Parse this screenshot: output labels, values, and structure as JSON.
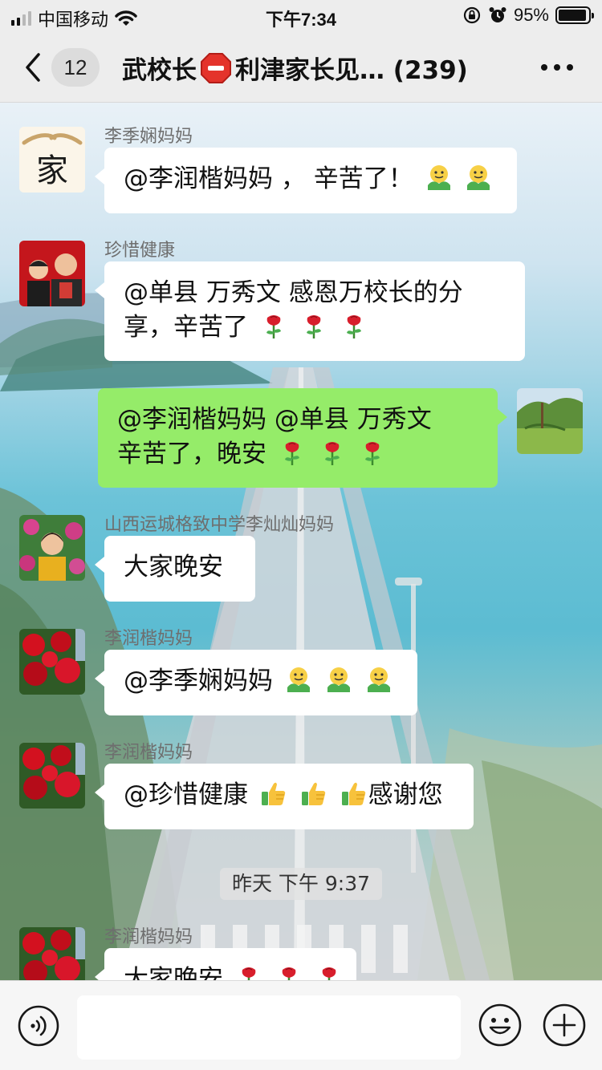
{
  "status_bar": {
    "carrier": "中国移动",
    "time": "下午7:34",
    "battery": "95%",
    "battery_level": 0.95,
    "signal_bars": 2
  },
  "header": {
    "unread_count": "12",
    "title_part1": "武校长",
    "title_icon": "stop-sign-emoji",
    "title_part2": "利津家长见… (239)"
  },
  "messages": [
    {
      "sender": "李季娴妈妈",
      "text": "@李润楷妈妈 ， 辛苦了！",
      "emojis": [
        "hugging-face",
        "hugging-face"
      ]
    },
    {
      "sender": "珍惜健康",
      "text_line1": "@单县  万秀文 感恩万校长的分",
      "text_line2": "享，辛苦了",
      "emojis": [
        "rose",
        "rose",
        "rose"
      ]
    },
    {
      "sender": "",
      "mine": true,
      "text_line1": "@李润楷妈妈 @单县  万秀文",
      "text_line2": "辛苦了，晚安",
      "emojis": [
        "rose",
        "rose",
        "rose"
      ]
    },
    {
      "sender": "山西运城格致中学李灿灿妈妈",
      "text": "大家晚安"
    },
    {
      "sender": "李润楷妈妈",
      "text": "@李季娴妈妈",
      "emojis": [
        "hugging-face",
        "hugging-face",
        "hugging-face"
      ]
    },
    {
      "sender": "李润楷妈妈",
      "text_before": "@珍惜健康",
      "emojis": [
        "thumbs-up",
        "thumbs-up",
        "thumbs-up"
      ],
      "text_after": "感谢您"
    },
    {
      "sender": "李润楷妈妈",
      "text": "大家晚安",
      "emojis": [
        "rose",
        "rose",
        "rose"
      ]
    }
  ],
  "time_divider": "昨天 下午 9:37",
  "input_bar": {
    "placeholder": ""
  },
  "colors": {
    "my_bubble": "#95ec69",
    "other_bubble": "#ffffff",
    "bar_background": "#ededed"
  }
}
